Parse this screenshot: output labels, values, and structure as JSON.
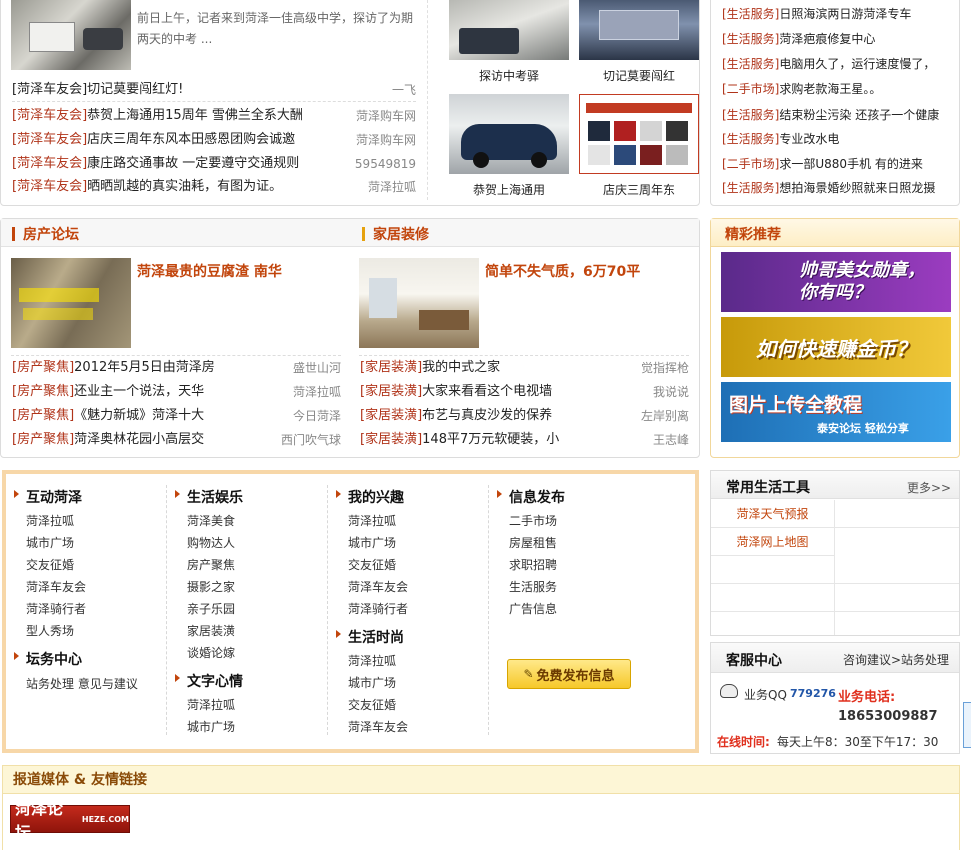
{
  "top_news": {
    "lead_summary": "前日上午，记者来到菏泽一佳高级中学，探访了为期两天的中考 ...",
    "headline": "[菏泽车友会]切记莫要闯红灯!",
    "headline_src": "一飞",
    "rows": [
      {
        "tag": "[菏泽车友会]",
        "title": "恭贺上海通用15周年 雪佛兰全系大酬",
        "src": "菏泽购车网"
      },
      {
        "tag": "[菏泽车友会]",
        "title": "店庆三周年东风本田感恩团购会诚邀",
        "src": "菏泽购车网"
      },
      {
        "tag": "[菏泽车友会]",
        "title": "康庄路交通事故 一定要遵守交通规则",
        "src": "59549819"
      },
      {
        "tag": "[菏泽车友会]",
        "title": "晒晒凯越的真实油耗，有图为证。",
        "src": "菏泽拉呱"
      }
    ]
  },
  "photo_grid": [
    {
      "caption": "探访中考驿"
    },
    {
      "caption": "切记莫要闯红"
    },
    {
      "caption": "恭贺上海通用"
    },
    {
      "caption": "店庆三周年东"
    }
  ],
  "services": [
    {
      "tag": "[生活服务]",
      "title": "日照海滨两日游菏泽专车"
    },
    {
      "tag": "[生活服务]",
      "title": "菏泽疤痕修复中心"
    },
    {
      "tag": "[生活服务]",
      "title": "电脑用久了，运行速度慢了，"
    },
    {
      "tag": "[二手市场]",
      "title": "求购老款海王星。。"
    },
    {
      "tag": "[生活服务]",
      "title": "结束粉尘污染 还孩子一个健康"
    },
    {
      "tag": "[生活服务]",
      "title": "专业改水电"
    },
    {
      "tag": "[二手市场]",
      "title": "求一部U880手机 有的进来"
    },
    {
      "tag": "[生活服务]",
      "title": "想拍海景婚纱照就来日照龙摄"
    }
  ],
  "house": {
    "header": "房产论坛",
    "feature_title": "菏泽最贵的豆腐渣 南华",
    "rows": [
      {
        "tag": "[房产聚焦]",
        "title": "2012年5月5日由菏泽房",
        "src": "盛世山河"
      },
      {
        "tag": "[房产聚焦]",
        "title": "还业主一个说法，天华",
        "src": "菏泽拉呱"
      },
      {
        "tag": "[房产聚焦]",
        "title": "《魅力新城》菏泽十大",
        "src": "今日菏泽"
      },
      {
        "tag": "[房产聚焦]",
        "title": "菏泽奥林花园小高层交",
        "src": "西门吹气球"
      }
    ]
  },
  "home": {
    "header": "家居装修",
    "feature_title": "简单不失气质，6万70平",
    "rows": [
      {
        "tag": "[家居装潢]",
        "title": "我的中式之家",
        "src": "觉指挥枪"
      },
      {
        "tag": "[家居装潢]",
        "title": "大家来看看这个电视墙",
        "src": "我说说"
      },
      {
        "tag": "[家居装潢]",
        "title": "布艺与真皮沙发的保养",
        "src": "左岸别离"
      },
      {
        "tag": "[家居装潢]",
        "title": "148平7万元软硬装，小",
        "src": "王志峰"
      }
    ]
  },
  "recommend": {
    "header": "精彩推荐",
    "banners": [
      {
        "text": "帅哥美女勋章，你有吗？",
        "colors": [
          "#5a2a8a",
          "#9b3cc0"
        ]
      },
      {
        "text": "如何快速赚金币？",
        "colors": [
          "#c79a0a",
          "#f1c93a"
        ]
      },
      {
        "text": "图片上传全教程",
        "sub": "泰安论坛 轻松分享",
        "colors": [
          "#1e6fb5",
          "#3aa0e8"
        ]
      }
    ]
  },
  "nav": {
    "col1": {
      "sections": [
        {
          "title": "互动菏泽",
          "links": [
            "菏泽拉呱",
            "城市广场",
            "交友征婚",
            "菏泽车友会",
            "菏泽骑行者",
            "型人秀场"
          ]
        },
        {
          "title": "坛务中心",
          "links": [
            "站务处理 意见与建议"
          ]
        }
      ]
    },
    "col2": {
      "sections": [
        {
          "title": "生活娱乐",
          "links": [
            "菏泽美食",
            "购物达人",
            "房产聚焦",
            "摄影之家",
            "亲子乐园",
            "家居装潢",
            "谈婚论嫁"
          ]
        },
        {
          "title": "文字心情",
          "links": [
            "菏泽拉呱",
            "城市广场"
          ]
        }
      ]
    },
    "col3": {
      "sections": [
        {
          "title": "我的兴趣",
          "links": [
            "菏泽拉呱",
            "城市广场",
            "交友征婚",
            "菏泽车友会",
            "菏泽骑行者"
          ]
        },
        {
          "title": "生活时尚",
          "links": [
            "菏泽拉呱",
            "城市广场",
            "交友征婚",
            "菏泽车友会"
          ]
        }
      ]
    },
    "col4": {
      "sections": [
        {
          "title": "信息发布",
          "links": [
            "二手市场",
            "房屋租售",
            "求职招聘",
            "生活服务",
            "广告信息"
          ]
        }
      ]
    },
    "publish_button": "免费发布信息"
  },
  "tools": {
    "header": "常用生活工具",
    "more": "更多>>",
    "items": [
      "菏泽天气预报",
      "菏泽网上地图"
    ]
  },
  "service_center": {
    "header": "客服中心",
    "links": "咨询建议>站务处理",
    "qq_label": "业务QQ",
    "qq_number": "779276",
    "phone_label": "业务电话:",
    "phone_number": "18653009887",
    "hours_label": "在线时间:",
    "hours": "每天上午8：30至下午17：30"
  },
  "media": {
    "header": "报道媒体 & 友情链接",
    "logo_text": "菏泽论坛",
    "logo_sub": "HEZE.COM"
  },
  "colors": {
    "accent": "#c2450c",
    "tag": "#b0341a",
    "nav_border": "#f7d7a8"
  }
}
